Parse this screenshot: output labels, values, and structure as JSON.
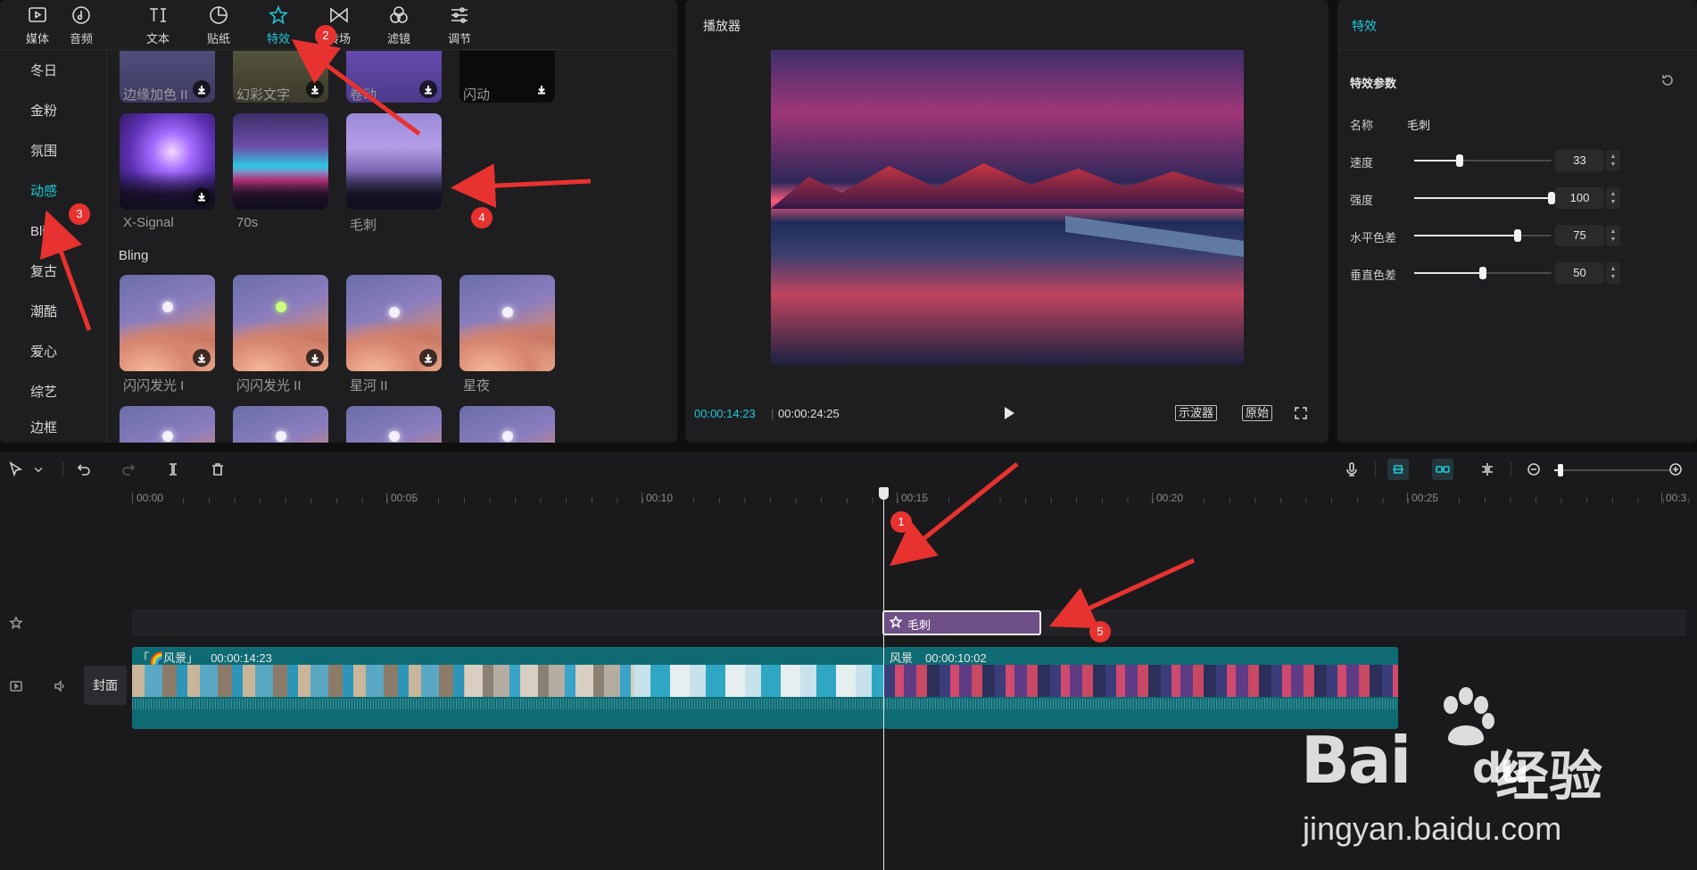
{
  "top_tabs": [
    {
      "label": "媒体",
      "icon": "media-icon"
    },
    {
      "label": "音频",
      "icon": "audio-icon"
    },
    {
      "label": "文本",
      "icon": "text-icon"
    },
    {
      "label": "贴纸",
      "icon": "sticker-icon"
    },
    {
      "label": "特效",
      "icon": "effects-icon",
      "active": true
    },
    {
      "label": "转场",
      "icon": "transition-icon"
    },
    {
      "label": "滤镜",
      "icon": "filter-icon"
    },
    {
      "label": "调节",
      "icon": "adjust-icon"
    }
  ],
  "side_categories": [
    {
      "label": "冬日"
    },
    {
      "label": "金粉"
    },
    {
      "label": "氛围"
    },
    {
      "label": "动感",
      "active": true
    },
    {
      "label": "Bling"
    },
    {
      "label": "复古"
    },
    {
      "label": "潮酷"
    },
    {
      "label": "爱心"
    },
    {
      "label": "综艺"
    },
    {
      "label": "边框"
    }
  ],
  "effects_top_row": [
    "边缘加色 II",
    "幻彩文字",
    "卷动",
    "闪动"
  ],
  "effects_dynamic": [
    "X-Signal",
    "70s",
    "毛刺"
  ],
  "section_bling": "Bling",
  "effects_bling": [
    "闪闪发光 I",
    "闪闪发光 II",
    "星河 II",
    "星夜"
  ],
  "player": {
    "title": "播放器",
    "current_time": "00:00:14:23",
    "total_time": "00:00:24:25",
    "separator": "|",
    "btn_scope": "示波器",
    "btn_original": "原始"
  },
  "props": {
    "tab": "特效",
    "section": "特效参数",
    "name_label": "名称",
    "name_value": "毛刺",
    "params": [
      {
        "label": "速度",
        "value": "33",
        "fraction": 0.33
      },
      {
        "label": "强度",
        "value": "100",
        "fraction": 1.0
      },
      {
        "label": "水平色差",
        "value": "75",
        "fraction": 0.75
      },
      {
        "label": "垂直色差",
        "value": "50",
        "fraction": 0.5
      }
    ]
  },
  "timeline": {
    "ruler": [
      "00:00",
      "00:05",
      "00:10",
      "00:15",
      "00:20",
      "00:25",
      "00:3"
    ],
    "zoom_fraction": 0.05,
    "effect_clip": "毛刺",
    "cover_label": "封面",
    "clip1_name": "「🌈风景」",
    "clip1_duration": "00:00:14:23",
    "clip2_name": "风景",
    "clip2_duration": "00:00:10:02"
  },
  "annotations": [
    "1",
    "2",
    "3",
    "4",
    "5"
  ],
  "accent_color": "#1fc8d8",
  "annotation_color": "#e8322f",
  "watermark": {
    "brand": "Bai",
    "brand_tail": "du",
    "cn": "经验",
    "url": "jingyan.baidu.com"
  }
}
